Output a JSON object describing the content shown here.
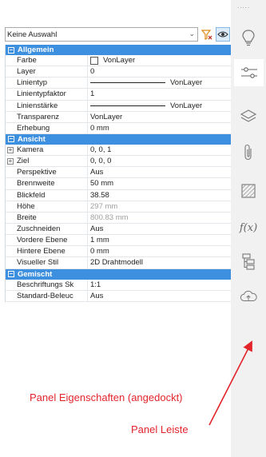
{
  "selection": {
    "value": "Keine Auswahl"
  },
  "groups": [
    {
      "title": "Allgemein",
      "rows": [
        {
          "label": "Farbe",
          "value": "VonLayer"
        },
        {
          "label": "Layer",
          "value": "0"
        },
        {
          "label": "Linientyp",
          "value": "VonLayer"
        },
        {
          "label": "Linientypfaktor",
          "value": "1"
        },
        {
          "label": "Linienstärke",
          "value": "VonLayer"
        },
        {
          "label": "Transparenz",
          "value": "VonLayer"
        },
        {
          "label": "Erhebung",
          "value": "0 mm"
        }
      ]
    },
    {
      "title": "Ansicht",
      "rows": [
        {
          "label": "Kamera",
          "value": "0, 0, 1"
        },
        {
          "label": "Ziel",
          "value": "0, 0, 0"
        },
        {
          "label": "Perspektive",
          "value": "Aus"
        },
        {
          "label": "Brennweite",
          "value": "50 mm"
        },
        {
          "label": "Blickfeld",
          "value": "38.58"
        },
        {
          "label": "Höhe",
          "value": "297 mm"
        },
        {
          "label": "Breite",
          "value": "800.83 mm"
        },
        {
          "label": "Zuschneiden",
          "value": "Aus"
        },
        {
          "label": "Vordere Ebene",
          "value": "1 mm"
        },
        {
          "label": "Hintere Ebene",
          "value": "0 mm"
        },
        {
          "label": "Visueller Stil",
          "value": "2D Drahtmodell"
        }
      ]
    },
    {
      "title": "Gemischt",
      "rows": [
        {
          "label": "Beschriftungs Sk",
          "value": "1:1"
        },
        {
          "label": "Standard-Beleuc",
          "value": "Aus"
        }
      ]
    }
  ],
  "sidebar": {
    "icons": [
      "lightbulb-icon",
      "sliders-icon",
      "layers-icon",
      "paperclip-icon",
      "hatch-icon",
      "function-icon",
      "tree-icon",
      "cloud-upload-icon"
    ],
    "fx_label": "f(x)"
  },
  "annotations": {
    "panel_label": "Panel Eigenschaften (angedockt)",
    "bar_label": "Panel Leiste",
    "color": "#e3242b"
  }
}
